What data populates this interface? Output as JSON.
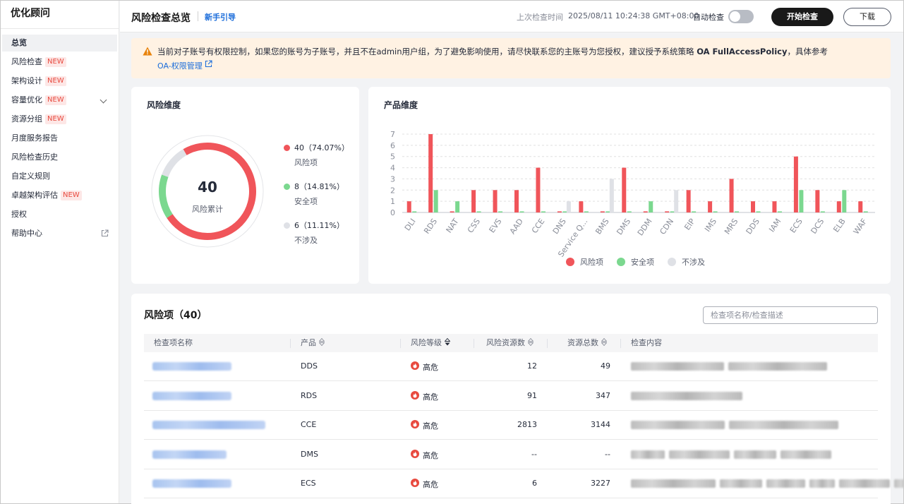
{
  "sidebar": {
    "title": "优化顾问",
    "items": [
      {
        "label": "总览",
        "active": true
      },
      {
        "label": "风险检查",
        "badge": "NEW"
      },
      {
        "label": "架构设计",
        "badge": "NEW"
      },
      {
        "label": "容量优化",
        "badge": "NEW",
        "expandable": true
      },
      {
        "label": "资源分组",
        "badge": "NEW"
      },
      {
        "label": "月度服务报告"
      },
      {
        "label": "风险检查历史"
      },
      {
        "label": "自定义规则"
      },
      {
        "label": "卓越架构评估",
        "badge": "NEW"
      },
      {
        "label": "授权"
      },
      {
        "label": "帮助中心",
        "external": true
      }
    ]
  },
  "header": {
    "title": "风险检查总览",
    "guide_link": "新手引导",
    "last_check_label": "上次检查时间",
    "last_check_time": "2025/08/11 10:24:38 GMT+08:00",
    "auto_check_label": "自动检查",
    "auto_check_on": false,
    "start_button": "开始检查",
    "download_button": "下载"
  },
  "alert": {
    "text_prefix": "当前对子账号有权限控制，如果您的账号为子账号，并且不在admin用户组，为了避免影响使用，请尽快联系您的主账号为您授权，建议授予系统策略 ",
    "policy": "OA FullAccessPolicy",
    "text_suffix": "，具体参考",
    "link": "OA-权限管理",
    "color": "#fff2e3"
  },
  "risk_dimension": {
    "title": "风险维度",
    "total": "40",
    "total_label": "风险累计",
    "items": [
      {
        "value": "40",
        "percent": "（74.07%）",
        "label": "风险项",
        "color": "#f0555a",
        "count": 40
      },
      {
        "value": "8",
        "percent": "（14.81%）",
        "label": "安全项",
        "color": "#7bd88f",
        "count": 8
      },
      {
        "value": "6",
        "percent": "（11.11%）",
        "label": "不涉及",
        "color": "#dfe1e6",
        "count": 6
      }
    ]
  },
  "product_dimension": {
    "title": "产品维度"
  },
  "chart_data": {
    "type": "bar",
    "title": "产品维度",
    "categories": [
      "DLI",
      "RDS",
      "NAT",
      "CSS",
      "EVS",
      "AAD",
      "CCE",
      "DNS",
      "Service Q...",
      "BMS",
      "DMS",
      "DDM",
      "CDN",
      "EIP",
      "IMS",
      "MRS",
      "DDS",
      "IAM",
      "ECS",
      "DCS",
      "ELB",
      "WAF"
    ],
    "series": [
      {
        "name": "风险项",
        "color": "#f0555a",
        "values": [
          1,
          7,
          0.1,
          2,
          2,
          2,
          4,
          0.1,
          1,
          0.1,
          4,
          0.1,
          0.1,
          2,
          1,
          3,
          1,
          1,
          5,
          2,
          1,
          1
        ]
      },
      {
        "name": "安全项",
        "color": "#7bd88f",
        "values": [
          0.1,
          2,
          1,
          0.1,
          0.1,
          0.1,
          0.1,
          0.1,
          0.1,
          0.1,
          0.1,
          1,
          0.1,
          0.1,
          0.1,
          0.1,
          0.1,
          0.1,
          2,
          0.1,
          2,
          0.1
        ]
      },
      {
        "name": "不涉及",
        "color": "#dfe1e6",
        "values": [
          0,
          0,
          0,
          0,
          0,
          0,
          0,
          1,
          0,
          3,
          0,
          0,
          2,
          0,
          0,
          0,
          0,
          0,
          0,
          0,
          0,
          0
        ]
      }
    ],
    "ylim": [
      0,
      7
    ],
    "yticks": [
      "0",
      "1",
      "2",
      "3",
      "4",
      "5",
      "6",
      "7"
    ],
    "grid": true,
    "legend": "bottom-center"
  },
  "risk_table": {
    "title": "风险项（40）",
    "search_placeholder": "检查项名称/检查描述",
    "columns": [
      "检查项名称",
      "产品",
      "风险等级",
      "风险资源数",
      "资源总数",
      "检查内容"
    ],
    "rows": [
      {
        "product": "DDS",
        "level": "高危",
        "risk_count": "12",
        "total": "49"
      },
      {
        "product": "RDS",
        "level": "高危",
        "risk_count": "91",
        "total": "347"
      },
      {
        "product": "CCE",
        "level": "高危",
        "risk_count": "2813",
        "total": "3144"
      },
      {
        "product": "DMS",
        "level": "高危",
        "risk_count": "--",
        "total": "--"
      },
      {
        "product": "ECS",
        "level": "高危",
        "risk_count": "6",
        "total": "3227"
      }
    ]
  }
}
